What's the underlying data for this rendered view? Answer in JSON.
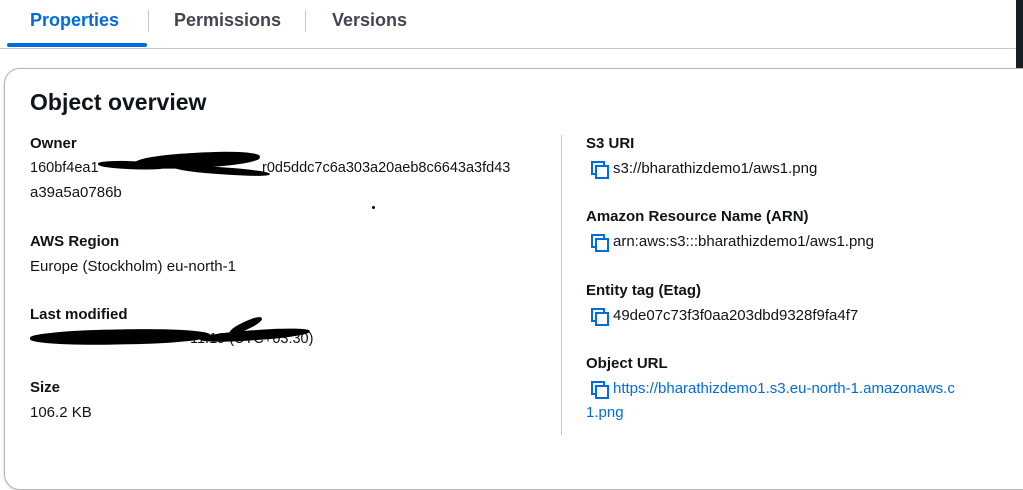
{
  "tabs": [
    {
      "label": "Properties",
      "active": true
    },
    {
      "label": "Permissions",
      "active": false
    },
    {
      "label": "Versions",
      "active": false
    }
  ],
  "overview": {
    "title": "Object overview",
    "owner": {
      "label": "Owner",
      "line1_visible": "160bf4ea1",
      "line1_tail": "r0d5ddc7c6a303a20aeb8c6643a3fd43",
      "line2": "a39a5a0786b"
    },
    "region": {
      "label": "AWS Region",
      "value": "Europe (Stockholm) eu-north-1"
    },
    "last_modified": {
      "label": "Last modified",
      "value_partial": "11:19 (UTC+03:30)"
    },
    "size": {
      "label": "Size",
      "value": "106.2 KB"
    },
    "s3_uri": {
      "label": "S3 URI",
      "value": "s3://bharathizdemo1/aws1.png",
      "icon": "copy-icon"
    },
    "arn": {
      "label": "Amazon Resource Name (ARN)",
      "value": "arn:aws:s3:::bharathizdemo1/aws1.png",
      "icon": "copy-icon"
    },
    "etag": {
      "label": "Entity tag (Etag)",
      "value": "49de07c73f3f0aa203dbd9328f9fa4f7",
      "icon": "copy-icon"
    },
    "object_url": {
      "label": "Object URL",
      "line1": "https://bharathizdemo1.s3.eu-north-1.amazonaws.c",
      "line2": "1.png",
      "icon": "copy-icon"
    }
  },
  "colors": {
    "accent": "#006ce0",
    "text": "#0f141a",
    "tab_text": "#424650",
    "border": "#c6c6cd"
  }
}
